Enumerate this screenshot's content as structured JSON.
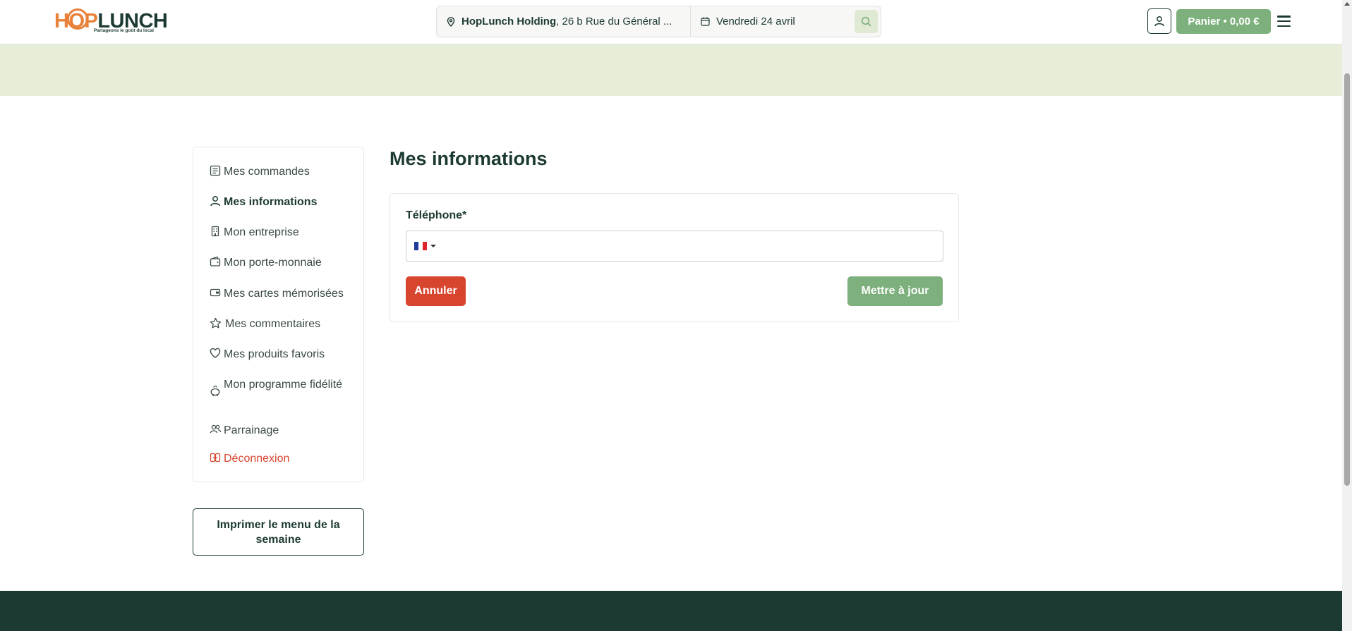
{
  "header": {
    "logo": {
      "hop": "HOP",
      "lunch": "LUNCH",
      "tagline": "Partageons le goût du local"
    },
    "address": {
      "strong": "HopLunch Holding",
      "rest": ", 26 b Rue du Général ..."
    },
    "date": "Vendredi 24 avril",
    "cart_label": "Panier • 0,00 €"
  },
  "sidebar": {
    "items": [
      {
        "label": "Mes commandes",
        "icon": "list-icon"
      },
      {
        "label": "Mes informations",
        "icon": "user-icon",
        "active": true
      },
      {
        "label": "Mon entreprise",
        "icon": "building-icon"
      },
      {
        "label": "Mon porte-monnaie",
        "icon": "wallet-icon"
      },
      {
        "label": "Mes cartes mémorisées",
        "icon": "card-icon"
      },
      {
        "label": "Mes commentaires",
        "icon": "star-icon"
      },
      {
        "label": "Mes produits favoris",
        "icon": "heart-icon"
      },
      {
        "label": "Mon programme fidélité",
        "icon": "piggy-bank-icon"
      },
      {
        "label": "Parrainage",
        "icon": "users-icon"
      },
      {
        "label": "Déconnexion",
        "icon": "logout-icon"
      }
    ],
    "print_label": "Imprimer le menu de la semaine"
  },
  "main": {
    "title": "Mes informations",
    "phone_label": "Téléphone*",
    "phone_value": "",
    "cancel_label": "Annuler",
    "update_label": "Mettre à jour"
  },
  "colors": {
    "brand_dark": "#1c3a33",
    "brand_orange": "#e8813a",
    "accent_green": "#7db07d",
    "danger": "#d8452f",
    "banner": "#e6eed8"
  }
}
